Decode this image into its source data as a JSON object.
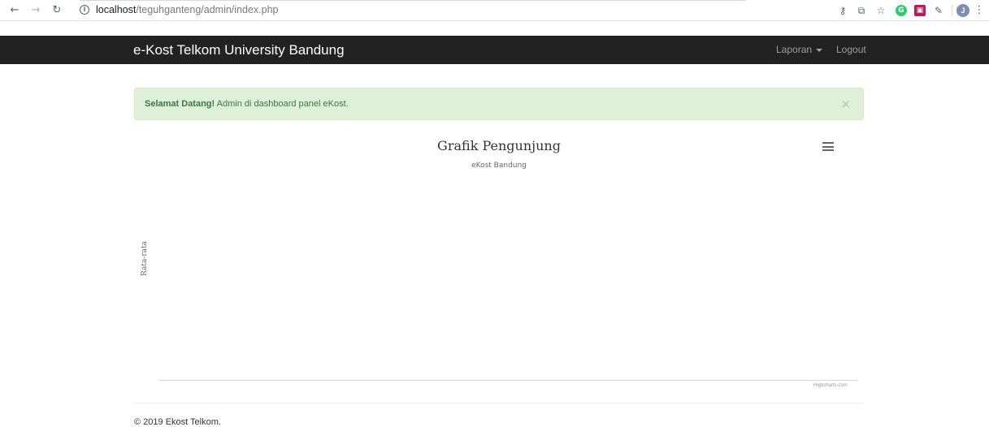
{
  "browser": {
    "url_host": "localhost",
    "url_path": "/teguhganteng/admin/index.php",
    "profile_initial": "J"
  },
  "navbar": {
    "brand": "e-Kost Telkom University Bandung",
    "laporan": "Laporan",
    "logout": "Logout"
  },
  "alert": {
    "strong": "Selamat Datang!",
    "message": " Admin di dashboard panel eKost.",
    "close": "×"
  },
  "chart_data": {
    "type": "line",
    "title": "Grafik Pengunjung",
    "subtitle": "eKost Bandung",
    "ylabel": "Rata-rata",
    "credit": "Highcharts.com",
    "series": []
  },
  "footer": {
    "text": "© 2019 Ekost Telkom."
  }
}
